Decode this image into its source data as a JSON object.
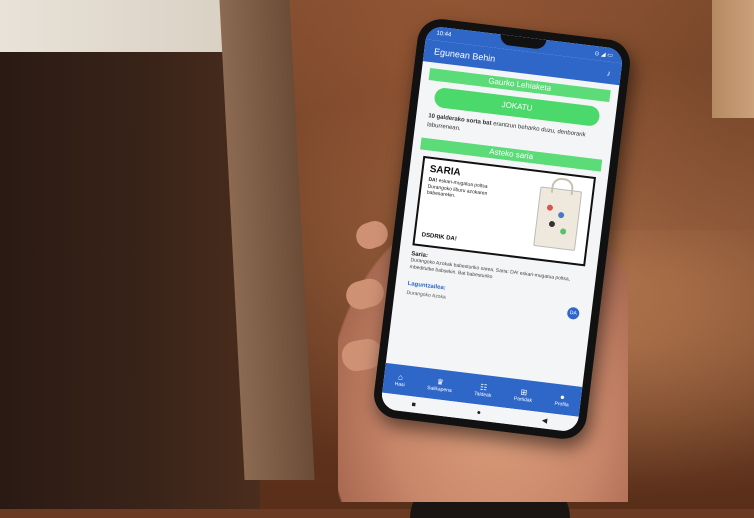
{
  "status": {
    "time": "10:44",
    "indicators": "⊙ ◢ ▭"
  },
  "app": {
    "title": "Egunean Behin"
  },
  "sections": {
    "play_header": "Gaurko Lehiaketa",
    "play_button": "JOKATU",
    "play_desc_bold": "10 galderako sorta bat",
    "play_desc_rest": "erantzun beharko duzu, denborarik laburrenean.",
    "prize_header": "Asteko saria"
  },
  "prize": {
    "card_title": "SARIA",
    "card_text_bold": "DA!",
    "card_text": "eskari-mugatua poltsa Durangoko liburu azokaren babesarekin.",
    "card_logo": "DSDRIK DA!",
    "heading": "Saria:",
    "text": "Durangoko Azokak babesturiko sarea. Saria: DA! eskari-mugatua poltsa, mbeditutke babsekin. Bat babesturiko"
  },
  "sponsor": {
    "heading": "Laguntzailea:",
    "name": "Durangoko Azoka",
    "fab": "DA"
  },
  "nav": [
    {
      "icon": "⌂",
      "label": "Hasi"
    },
    {
      "icon": "♛",
      "label": "Sailkapena"
    },
    {
      "icon": "☷",
      "label": "Taldeak"
    },
    {
      "icon": "⊞",
      "label": "Partidak"
    },
    {
      "icon": "●",
      "label": "Profila"
    }
  ],
  "sysnav": {
    "square": "■",
    "circle": "●",
    "back": "◀"
  }
}
